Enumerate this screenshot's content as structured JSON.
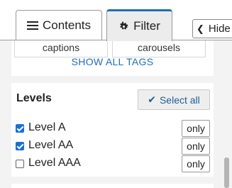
{
  "tabs": {
    "contents_label": "Contents",
    "filter_label": "Filter",
    "contents_icon": "list-icon",
    "filter_icon": "gear-icon"
  },
  "hide_button": {
    "label": "Hide",
    "icon": "chevron-left-icon"
  },
  "tags": {
    "items": [
      "captions",
      "carousels"
    ],
    "show_all_label": "SHOW ALL TAGS"
  },
  "levels": {
    "title": "Levels",
    "select_all_label": "Select all",
    "select_all_icon": "checkmark-icon",
    "items": [
      {
        "label": "Level A",
        "checked": true,
        "only_label": "only"
      },
      {
        "label": "Level AA",
        "checked": true,
        "only_label": "only"
      },
      {
        "label": "Level AAA",
        "checked": false,
        "only_label": "only"
      }
    ]
  },
  "colors": {
    "accent": "#1f6fb5",
    "checkbox": "#1a6fd1",
    "background": "#f3f3f3"
  }
}
